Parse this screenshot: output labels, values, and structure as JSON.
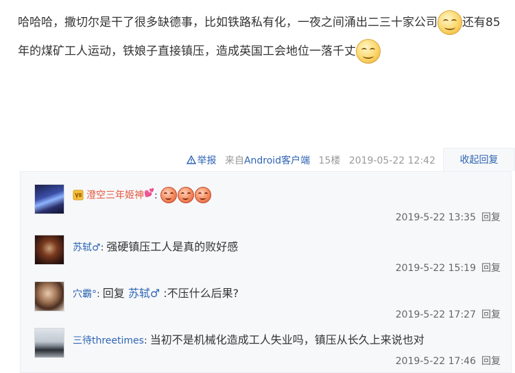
{
  "post": {
    "text_part1": "哈哈哈，撒切尔是干了很多缺德事，比如铁路私有化，一夜之间涌出二三十家公司",
    "text_part2": "还有85年的煤矿工人运动，铁娘子直接镇压，造成英国工会地位一落千丈",
    "emoji_1": "smile-emoji",
    "emoji_2": "smile-emoji"
  },
  "meta": {
    "report_label": "举报",
    "source_prefix": "来自",
    "source_client": "Android客户端",
    "floor": "15楼",
    "datetime": "2019-05-22 12:42",
    "collapse_label": "收起回复"
  },
  "replies": [
    {
      "username": "澄空三年姬神",
      "colon": ":",
      "text": "",
      "emojis": [
        "angry-emoji",
        "angry-emoji",
        "angry-emoji"
      ],
      "datetime": "2019-5-22 13:35",
      "reply_label": "回复"
    },
    {
      "username": "苏轼♂",
      "colon": ":",
      "text": "强硬镇压工人是真的败好感",
      "datetime": "2019-5-22 15:19",
      "reply_label": "回复"
    },
    {
      "username": "穴霸°",
      "colon": ":",
      "reply_prefix": "回复",
      "at_user": "苏轼♂",
      "text": ":不压什么后果?",
      "datetime": "2019-5-22 17:27",
      "reply_label": "回复"
    },
    {
      "username": "三待threetimes",
      "colon": ":",
      "text": "当初不是机械化造成工人失业吗，镇压从长久上来说也对",
      "datetime": "2019-5-22 17:46",
      "reply_label": "回复"
    }
  ],
  "colors": {
    "link": "#2d64b3",
    "username_red": "#e4573f",
    "meta_gray": "#999999",
    "reply_bg": "#f7f8fa"
  }
}
